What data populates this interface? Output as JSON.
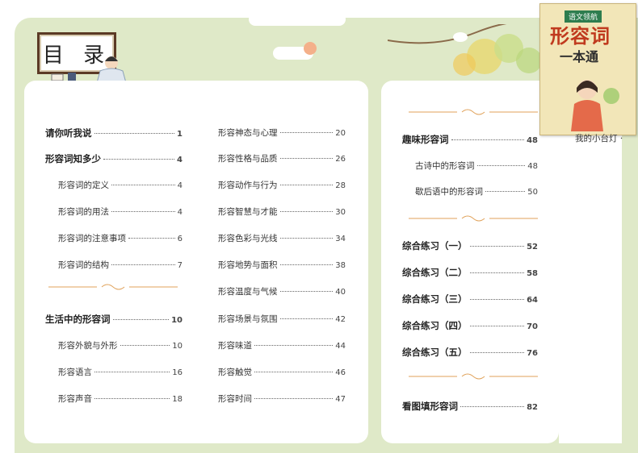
{
  "header": {
    "title": "目 录"
  },
  "book": {
    "badge": "语文领航",
    "title": "形容词",
    "subtitle": "一本通"
  },
  "note": "我的小台灯 ·",
  "left_col1": [
    {
      "label": "请你听我说",
      "page": "1",
      "h": true
    },
    {
      "label": "形容词知多少",
      "page": "4",
      "h": true
    },
    {
      "label": "形容词的定义",
      "page": "4",
      "h": false
    },
    {
      "label": "形容词的用法",
      "page": "4",
      "h": false
    },
    {
      "label": "形容词的注意事项",
      "page": "6",
      "h": false
    },
    {
      "label": "形容词的结构",
      "page": "7",
      "h": false
    },
    {
      "label": "生活中的形容词",
      "page": "10",
      "h": true
    },
    {
      "label": "形容外貌与外形",
      "page": "10",
      "h": false
    },
    {
      "label": "形容语言",
      "page": "16",
      "h": false
    },
    {
      "label": "形容声音",
      "page": "18",
      "h": false
    }
  ],
  "left_col2": [
    {
      "label": "形容神态与心理",
      "page": "20"
    },
    {
      "label": "形容性格与品质",
      "page": "26"
    },
    {
      "label": "形容动作与行为",
      "page": "28"
    },
    {
      "label": "形容智慧与才能",
      "page": "30"
    },
    {
      "label": "形容色彩与光线",
      "page": "34"
    },
    {
      "label": "形容地势与面积",
      "page": "38"
    },
    {
      "label": "形容温度与气候",
      "page": "40"
    },
    {
      "label": "形容场景与氛围",
      "page": "42"
    },
    {
      "label": "形容味道",
      "page": "44"
    },
    {
      "label": "形容触觉",
      "page": "46"
    },
    {
      "label": "形容时间",
      "page": "47"
    }
  ],
  "right_col": [
    {
      "label": "趣味形容词",
      "page": "48",
      "h": true
    },
    {
      "label": "古诗中的形容词",
      "page": "48",
      "h": false
    },
    {
      "label": "歇后语中的形容词",
      "page": "50",
      "h": false
    },
    {
      "label": "综合练习（一）",
      "page": "52",
      "h": true
    },
    {
      "label": "综合练习（二）",
      "page": "58",
      "h": true
    },
    {
      "label": "综合练习（三）",
      "page": "64",
      "h": true
    },
    {
      "label": "综合练习（四）",
      "page": "70",
      "h": true
    },
    {
      "label": "综合练习（五）",
      "page": "76",
      "h": true
    },
    {
      "label": "看图填形容词",
      "page": "82",
      "h": true
    }
  ],
  "colors": {
    "background": "#dfe9c8",
    "divider": "#e0a25a",
    "book_title": "#c03a1e"
  }
}
